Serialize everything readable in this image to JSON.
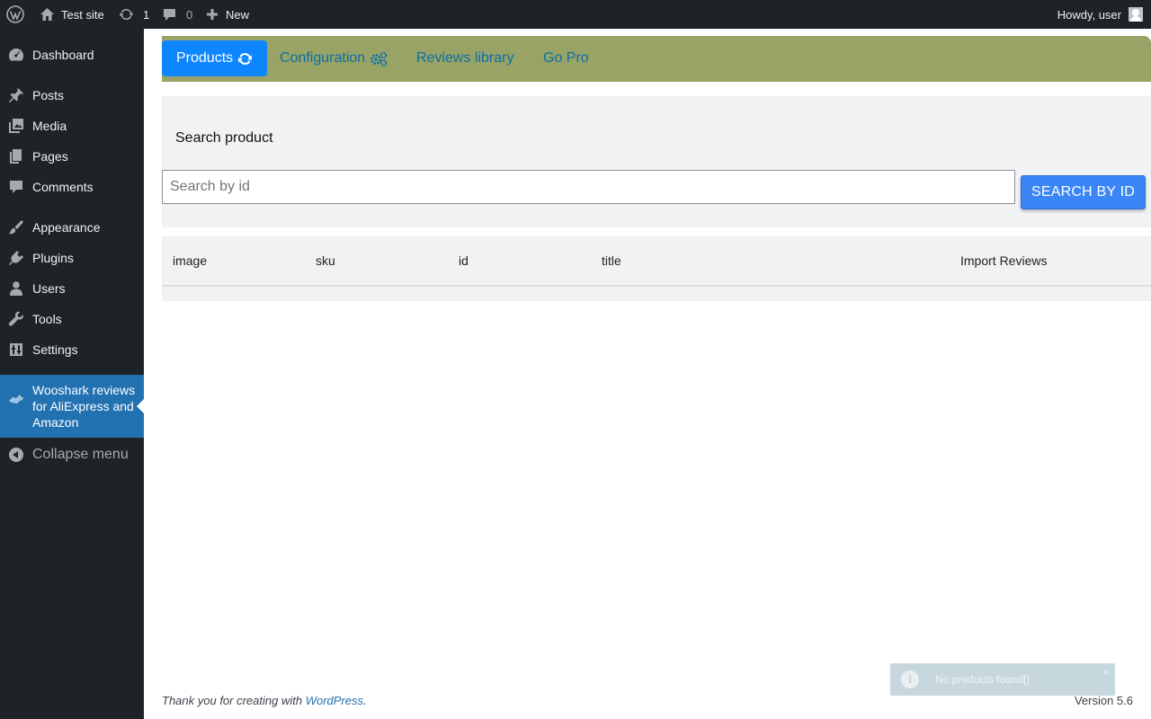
{
  "adminbar": {
    "site_name": "Test site",
    "updates_count": "1",
    "comments_count": "0",
    "new_label": "New",
    "greeting": "Howdy, user"
  },
  "sidebar": {
    "items": [
      {
        "label": "Dashboard",
        "icon": "dashboard-icon"
      },
      {
        "label": "Posts",
        "icon": "pin-icon"
      },
      {
        "label": "Media",
        "icon": "media-icon"
      },
      {
        "label": "Pages",
        "icon": "pages-icon"
      },
      {
        "label": "Comments",
        "icon": "comment-icon"
      },
      {
        "label": "Appearance",
        "icon": "paintbrush-icon"
      },
      {
        "label": "Plugins",
        "icon": "plugin-icon"
      },
      {
        "label": "Users",
        "icon": "users-icon"
      },
      {
        "label": "Tools",
        "icon": "wrench-icon"
      },
      {
        "label": "Settings",
        "icon": "settings-icon"
      },
      {
        "label": "Wooshark reviews for AliExpress and Amazon",
        "icon": "wooshark-icon"
      },
      {
        "label": "Collapse menu",
        "icon": "collapse-icon"
      }
    ]
  },
  "tabs": [
    {
      "label": "Products",
      "icon": "refresh-icon",
      "active": true
    },
    {
      "label": "Configuration",
      "icon": "cogs-icon",
      "active": false
    },
    {
      "label": "Reviews library",
      "active": false
    },
    {
      "label": "Go Pro",
      "active": false
    }
  ],
  "search": {
    "heading": "Search product",
    "placeholder": "Search by id",
    "value": "",
    "button_label": "SEARCH BY ID"
  },
  "table": {
    "columns": [
      "image",
      "sku",
      "id",
      "title",
      "Import Reviews"
    ],
    "rows": []
  },
  "footer": {
    "thanks_text": "Thank you for creating with ",
    "link_text": "WordPress",
    "period": ".",
    "version": "Version 5.6"
  },
  "toast": {
    "message": "No products found[]",
    "close": "×",
    "icon": "i"
  },
  "colors": {
    "adminbar_bg": "#1d2327",
    "sidebar_bg": "#1d2327",
    "current_menu_bg": "#2271b1",
    "tabbar_bg": "#98a365",
    "active_tab_bg": "#0d86ff",
    "search_button_bg": "#3b86f7"
  }
}
